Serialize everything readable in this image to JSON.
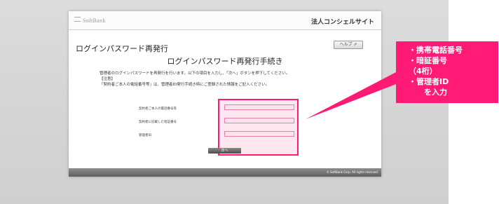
{
  "header": {
    "logo_text": "SoftBank",
    "site_title": "法人コンシェルサイト"
  },
  "page": {
    "title": "ログインパスワード再発行",
    "help_label": "ヘルプ ⇗",
    "section_title": "ログインパスワード再発行手続き"
  },
  "notes": [
    "管理者のログインパスワードを再発行を行います。以下の項目を入力し、「次へ」ボタンを押下してください。",
    "【注意】",
    "「契約者ご本人の電話番号等」は、管理者ID発行手続き時にご登録された情報をご記入ください。"
  ],
  "form": {
    "fields": [
      {
        "label": "契約者ご本人の電話番号等",
        "value": ""
      },
      {
        "label": "契約者に記載した暗証番号",
        "value": ""
      },
      {
        "label": "管理者ID",
        "value": ""
      }
    ],
    "next_label": "次へ"
  },
  "footer": {
    "copyright": "© SoftBank Corp. All rights reserved."
  },
  "callout": {
    "lines": [
      "・携帯電話番号",
      "・暗証番号",
      "（4桁）",
      "・管理者ID",
      "　　を入力"
    ],
    "color": "#ff1a75"
  }
}
